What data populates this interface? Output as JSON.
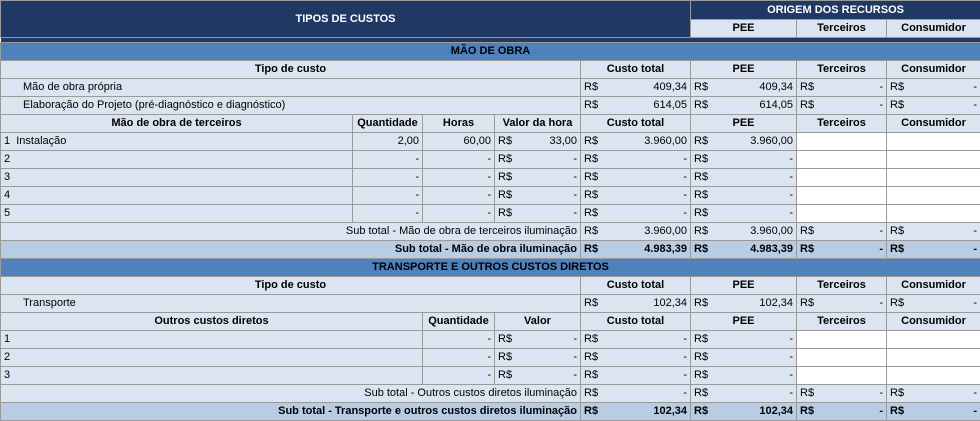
{
  "top": {
    "tipos": "TIPOS DE CUSTOS",
    "origem": "ORIGEM DOS RECURSOS",
    "pee": "PEE",
    "terceiros": "Terceiros",
    "consumidor": "Consumidor"
  },
  "mao_de_obra": {
    "title": "MÃO DE OBRA",
    "hdr": {
      "tipo": "Tipo de custo",
      "custo_total": "Custo total",
      "pee": "PEE",
      "terceiros": "Terceiros",
      "consumidor": "Consumidor"
    },
    "rows": [
      {
        "label": "Mão de obra própria",
        "cur": "R$",
        "custo": "409,34",
        "pee": "409,34",
        "terc": "-",
        "cons": "-"
      },
      {
        "label": "Elaboração do Projeto (pré-diagnóstico e diagnóstico)",
        "cur": "R$",
        "custo": "614,05",
        "pee": "614,05",
        "terc": "-",
        "cons": "-"
      }
    ],
    "terceiros_hdr": {
      "label": "Mão de obra de terceiros",
      "quantidade": "Quantidade",
      "horas": "Horas",
      "valor_hora": "Valor da hora",
      "custo_total": "Custo total",
      "pee": "PEE",
      "terceiros": "Terceiros",
      "consumidor": "Consumidor"
    },
    "terceiros_rows": [
      {
        "n": "1",
        "label": "Instalação",
        "qtd": "2,00",
        "horas": "60,00",
        "valor": "33,00",
        "custo": "3.960,00",
        "pee": "3.960,00"
      },
      {
        "n": "2",
        "label": "",
        "qtd": "-",
        "horas": "-",
        "valor": "-",
        "custo": "-",
        "pee": "-"
      },
      {
        "n": "3",
        "label": "",
        "qtd": "-",
        "horas": "-",
        "valor": "-",
        "custo": "-",
        "pee": "-"
      },
      {
        "n": "4",
        "label": "",
        "qtd": "-",
        "horas": "-",
        "valor": "-",
        "custo": "-",
        "pee": "-"
      },
      {
        "n": "5",
        "label": "",
        "qtd": "-",
        "horas": "-",
        "valor": "-",
        "custo": "-",
        "pee": "-"
      }
    ],
    "subtotal_terceiros": {
      "label": "Sub total - Mão de obra de terceiros iluminação",
      "custo": "3.960,00",
      "pee": "3.960,00",
      "terc": "-",
      "cons": "-"
    },
    "subtotal": {
      "label": "Sub total - Mão de obra iluminação",
      "custo": "4.983,39",
      "pee": "4.983,39",
      "terc": "-",
      "cons": "-"
    }
  },
  "transporte": {
    "title": "TRANSPORTE E OUTROS CUSTOS DIRETOS",
    "hdr": {
      "tipo": "Tipo de custo",
      "custo_total": "Custo total",
      "pee": "PEE",
      "terceiros": "Terceiros",
      "consumidor": "Consumidor"
    },
    "row": {
      "label": "Transporte",
      "custo": "102,34",
      "pee": "102,34",
      "terc": "-",
      "cons": "-"
    },
    "outros_hdr": {
      "label": "Outros custos diretos",
      "quantidade": "Quantidade",
      "valor": "Valor",
      "custo_total": "Custo total",
      "pee": "PEE",
      "terceiros": "Terceiros",
      "consumidor": "Consumidor"
    },
    "outros_rows": [
      {
        "n": "1",
        "qtd": "-",
        "valor": "-",
        "custo": "-",
        "pee": "-"
      },
      {
        "n": "2",
        "qtd": "-",
        "valor": "-",
        "custo": "-",
        "pee": "-"
      },
      {
        "n": "3",
        "qtd": "-",
        "valor": "-",
        "custo": "-",
        "pee": "-"
      }
    ],
    "subtotal_outros": {
      "label": "Sub total - Outros custos diretos iluminação",
      "custo": "-",
      "pee": "-",
      "terc": "-",
      "cons": "-"
    },
    "subtotal": {
      "label": "Sub total - Transporte e outros custos diretos iluminação",
      "custo": "102,34",
      "pee": "102,34",
      "terc": "-",
      "cons": "-"
    }
  },
  "currency": "R$"
}
